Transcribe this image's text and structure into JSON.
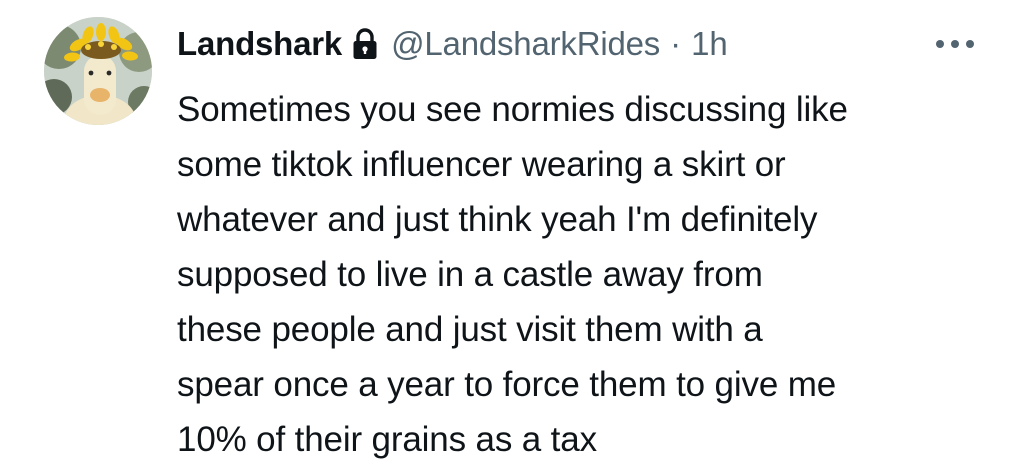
{
  "tweet": {
    "author": {
      "display_name": "Landshark",
      "handle": "@LandsharkRides",
      "protected_icon": "lock-icon",
      "avatar_icon": "duck-with-flower-crown-avatar"
    },
    "separator": "·",
    "timestamp": "1h",
    "more_icon": "more-horizontal-icon",
    "text_lines": [
      "Sometimes you see normies discussing like",
      "some tiktok influencer wearing a skirt or",
      "whatever and just think yeah I'm definitely",
      "supposed to live in a castle away from",
      "these people and just visit them with a",
      "spear once a year to force them to give me",
      "10% of their grains as a tax"
    ]
  },
  "colors": {
    "primary_text": "#0f1419",
    "secondary_text": "#536471",
    "background": "#ffffff"
  }
}
